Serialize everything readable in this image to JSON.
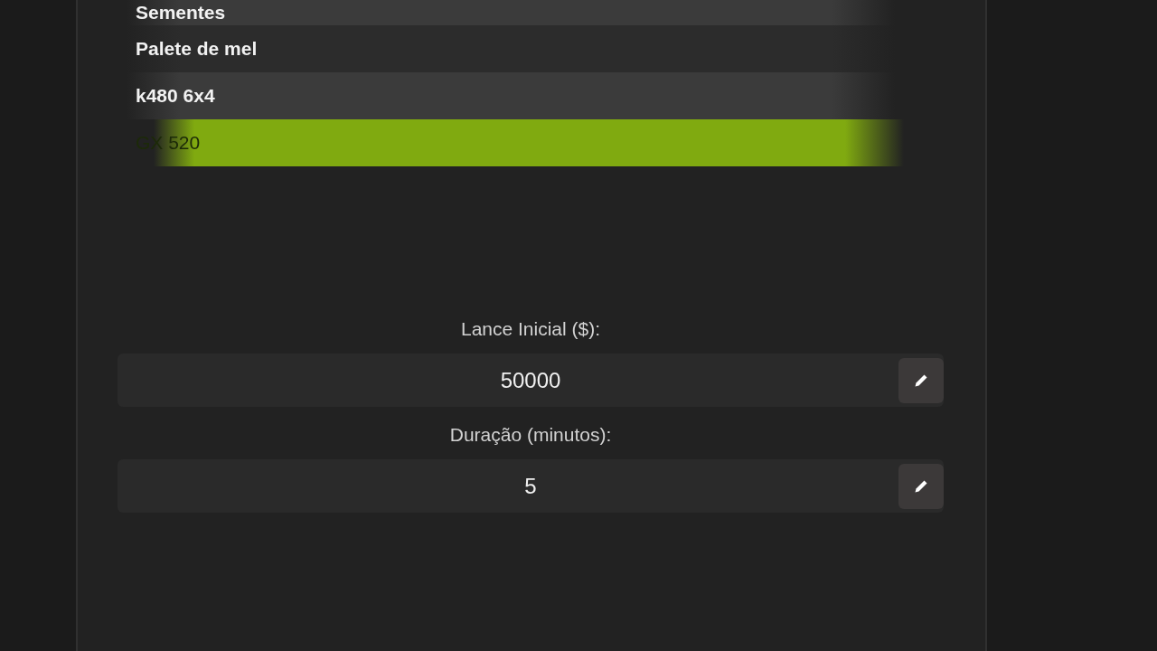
{
  "item_list": [
    {
      "label": "Sementes",
      "selected": false
    },
    {
      "label": "Palete de mel",
      "selected": false
    },
    {
      "label": "k480 6x4",
      "selected": false
    },
    {
      "label": "GX 520",
      "selected": true
    }
  ],
  "fields": [
    {
      "label": "Lance Inicial ($):",
      "value": "50000"
    },
    {
      "label": "Duração (minutos):",
      "value": "5"
    }
  ]
}
